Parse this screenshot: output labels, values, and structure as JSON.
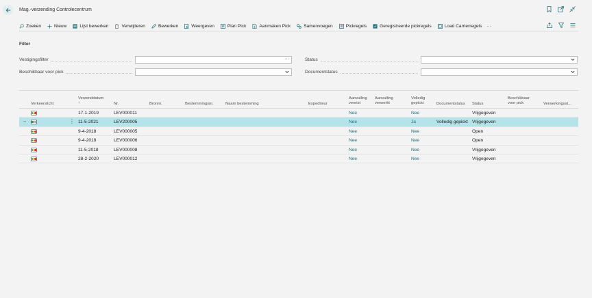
{
  "window": {
    "title": "Mag.-verzending Controlecentrum"
  },
  "icons": {
    "back": "arrow-left-icon",
    "bookmark": "bookmark-icon",
    "open_new": "open-in-new-window-icon",
    "collapse": "collapse-icon",
    "share": "share-icon",
    "filter": "filter-icon",
    "list": "list-icon"
  },
  "actions": [
    {
      "label": "Zoeken",
      "icon": "search-icon"
    },
    {
      "label": "Nieuw",
      "icon": "plus-icon"
    },
    {
      "label": "Lijst bewerken",
      "icon": "edit-list-icon"
    },
    {
      "label": "Verwijderen",
      "icon": "trash-icon"
    },
    {
      "label": "Bewerken",
      "icon": "pencil-icon"
    },
    {
      "label": "Weergeven",
      "icon": "view-icon"
    },
    {
      "label": "Plan Pick",
      "icon": "plan-icon"
    },
    {
      "label": "Aanmaken Pick",
      "icon": "create-doc-icon"
    },
    {
      "label": "Samenvoegen",
      "icon": "merge-icon"
    },
    {
      "label": "Pickregels",
      "icon": "pick-lines-icon"
    },
    {
      "label": "Geregistreerde pickregels",
      "icon": "registered-lines-icon"
    },
    {
      "label": "Load Carrierregels",
      "icon": "carrier-lines-icon"
    }
  ],
  "more_label": "···",
  "filter": {
    "caption": "Filter",
    "vestigingsfilter": {
      "label": "Vestigingsfilter",
      "value": "",
      "assist": "···"
    },
    "beschikbaar": {
      "label": "Beschikbaar voor pick",
      "value": ""
    },
    "status": {
      "label": "Status",
      "value": ""
    },
    "documentstatus": {
      "label": "Documentstatus",
      "value": ""
    }
  },
  "columns": {
    "verkeerslicht": "Verkeerslicht",
    "verzenddatum": "Verzenddatum",
    "sort_arrow": "↑",
    "nr": "Nr.",
    "bronnr": "Bronnr.",
    "bestemmingsnr": "Bestemmingsnr.",
    "naam_bestemming": "Naam bestemming",
    "expediteur": "Expediteur",
    "aanvulling_vereist_1": "Aanvulling",
    "aanvulling_vereist_2": "vereist",
    "aanvulling_verwerkt_1": "Aanvulling",
    "aanvulling_verwerkt_2": "verwerkt",
    "volledig_gepickt_1": "Volledig",
    "volledig_gepickt_2": "gepickt",
    "documentstatus": "Documentstatus",
    "status": "Status",
    "beschikbaar_1": "Beschikbaar",
    "beschikbaar_2": "voor pick",
    "verwerkingsst": "Verwerkingsst..."
  },
  "rows": [
    {
      "date": "17-1-2019",
      "nr": "LEV000011",
      "aanvulling": "Nee",
      "volledig": "Nee",
      "docstatus": "",
      "status": "Vrijgegeven",
      "selected": false,
      "light": "red"
    },
    {
      "date": "11-5-2021",
      "nr": "LEV200005",
      "aanvulling": "Nee",
      "volledig": "Ja",
      "docstatus": "Volledig gepickt",
      "status": "Vrijgegeven",
      "selected": true,
      "light": "green"
    },
    {
      "date": "9-4-2018",
      "nr": "LEV000005",
      "aanvulling": "Nee",
      "volledig": "Nee",
      "docstatus": "",
      "status": "Open",
      "selected": false,
      "light": "red"
    },
    {
      "date": "9-4-2018",
      "nr": "LEV000006",
      "aanvulling": "Nee",
      "volledig": "Nee",
      "docstatus": "",
      "status": "Open",
      "selected": false,
      "light": "red"
    },
    {
      "date": "11-5-2018",
      "nr": "LEV000008",
      "aanvulling": "Nee",
      "volledig": "Nee",
      "docstatus": "",
      "status": "Vrijgegeven",
      "selected": false,
      "light": "red"
    },
    {
      "date": "28-2-2020",
      "nr": "LEV000012",
      "aanvulling": "Nee",
      "volledig": "Nee",
      "docstatus": "",
      "status": "Vrijgegeven",
      "selected": false,
      "light": "red"
    }
  ],
  "row_arrow": "→",
  "row_menu": "⋮",
  "colors": {
    "accent": "#1e6f7a",
    "selected_row": "#b4e3e9",
    "light_red": "#d8322e",
    "light_green": "#2e9e3f"
  }
}
